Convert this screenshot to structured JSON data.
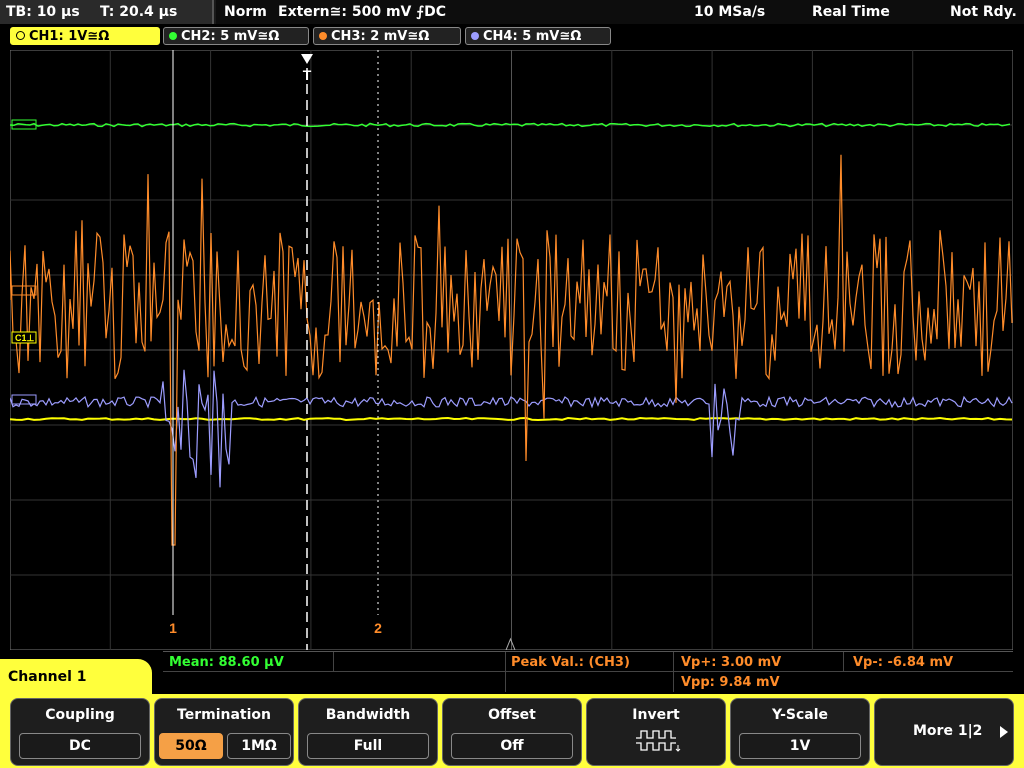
{
  "top": {
    "tb": "TB: 10 µs",
    "t": "T: 20.4 µs",
    "mode": "Norm",
    "trigger": "Extern≅: 500 mV ⨍DC",
    "rate": "10 MSa/s",
    "acq": "Real Time",
    "status": "Not Rdy."
  },
  "channels": [
    {
      "label": "CH1: 1V≅Ω",
      "color": "#ffff00"
    },
    {
      "label": "CH2: 5 mV≅Ω",
      "color": "#33ff33"
    },
    {
      "label": "CH3: 2 mV≅Ω",
      "color": "#ff8c2a"
    },
    {
      "label": "CH4: 5 mV≅Ω",
      "color": "#9d9dff"
    }
  ],
  "markers": {
    "trigger": "T",
    "cursor1": "1",
    "cursor2": "2",
    "ch1_tag": "C1⊥"
  },
  "measurements": {
    "mean": "Mean: 88.60 µV",
    "peak": "Peak Val.: (CH3)",
    "vpp_plus": "Vp+: 3.00 mV",
    "vpp_minus": "Vp-: -6.84 mV",
    "vpp": "Vpp: 9.84 mV"
  },
  "menu": {
    "title": "Channel 1",
    "coupling": {
      "title": "Coupling",
      "value": "DC"
    },
    "termination": {
      "title": "Termination",
      "opt1": "50Ω",
      "opt2": "1MΩ"
    },
    "bandwidth": {
      "title": "Bandwidth",
      "value": "Full"
    },
    "offset": {
      "title": "Offset",
      "value": "Off"
    },
    "invert": {
      "title": "Invert"
    },
    "yscale": {
      "title": "Y-Scale",
      "value": "1V"
    },
    "more": {
      "title": "More 1|2"
    }
  }
}
